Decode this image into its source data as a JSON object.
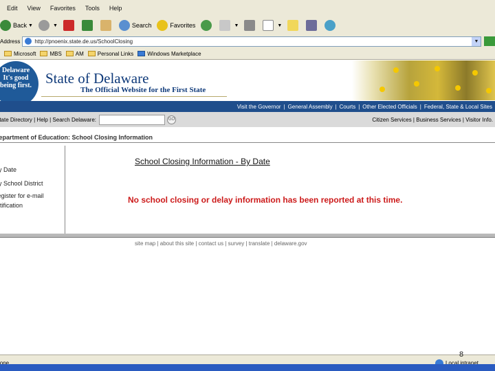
{
  "menu": [
    "Edit",
    "View",
    "Favorites",
    "Tools",
    "Help"
  ],
  "toolbar": {
    "back_label": "Back",
    "search_label": "Search",
    "favorites_label": "Favorites"
  },
  "address": {
    "label": "Address",
    "url": "http://pnoenix.state.de.us/SchoolClosing"
  },
  "links": [
    "Microsoft",
    "MBS",
    "AM",
    "Personal Links",
    "Windows Marketplace"
  ],
  "seal": {
    "line1": "Delaware",
    "line2": "It's good",
    "line3": "being first."
  },
  "header": {
    "title": "State of Delaware",
    "subtitle": "The Official Website for the First State"
  },
  "nav": [
    "Visit the Governor",
    "General Assembly",
    "Courts",
    "Other Elected Officials",
    "Federal, State & Local Sites"
  ],
  "searchbar": {
    "left_text": "State Directory | Help | Search Delaware:",
    "go_label": "GO",
    "right_text": "Citizen Services | Business Services | Visitor Info."
  },
  "dept_title": "Department of Education: School Closing Information",
  "leftnav": [
    "By Date",
    "By School District",
    "Register for e-mail",
    "notification"
  ],
  "content": {
    "heading": "School Closing Information - By Date",
    "notice": "No school closing or delay information has been reported at this time."
  },
  "footer": "site map  |  about this site  |  contact us  |  survey  |  translate  |  delaware.gov",
  "status": {
    "left": "Done",
    "zone": "Local intranet"
  },
  "page_number": "8",
  "colors": {
    "brand_blue": "#1f4e8c",
    "notice_red": "#cc1a1a"
  }
}
